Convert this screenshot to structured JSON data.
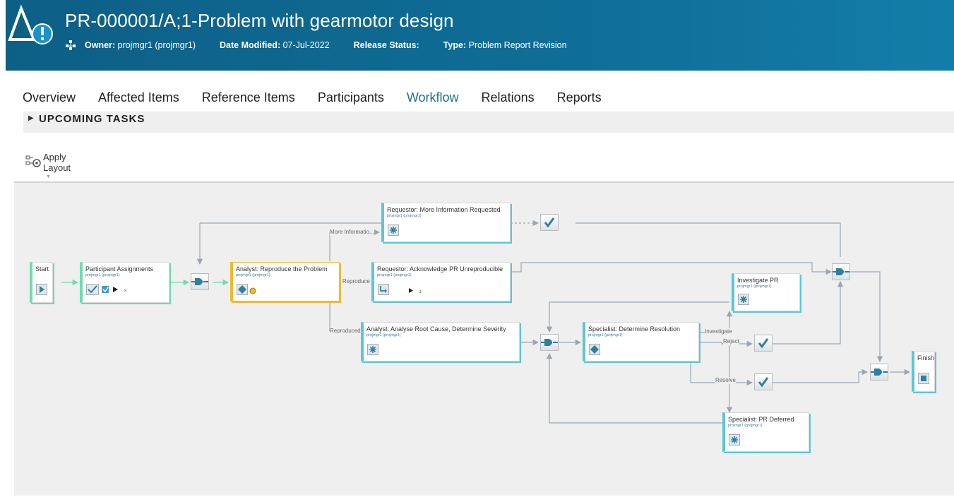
{
  "header": {
    "title": "PR-000001/A;1-Problem with gearmotor design",
    "owner_label": "Owner:",
    "owner_value": "projmgr1 (projmgr1)",
    "date_label": "Date Modified:",
    "date_value": "07-Jul-2022",
    "release_label": "Release Status:",
    "type_label": "Type:",
    "type_value": "Problem Report Revision",
    "header_color": "#0f6e97"
  },
  "tabs": [
    {
      "label": "Overview"
    },
    {
      "label": "Affected Items"
    },
    {
      "label": "Reference Items"
    },
    {
      "label": "Participants"
    },
    {
      "label": "Workflow",
      "active": true
    },
    {
      "label": "Relations"
    },
    {
      "label": "Reports"
    }
  ],
  "upcoming": {
    "label": "UPCOMING TASKS"
  },
  "toolbar": {
    "apply_layout_label": "Apply Layout"
  },
  "workflow": {
    "nodes": {
      "start": {
        "title": "Start"
      },
      "participant": {
        "title": "Participant Assignments",
        "owner": "projmgr1 (projmgr1)",
        "count": "s"
      },
      "reproduce": {
        "title": "Analyst: Reproduce the Problem",
        "owner": "projmgr1 (projmgr1)"
      },
      "more_info": {
        "title": "Requestor: More Information Requested",
        "owner": "projmgr1 (projmgr1)"
      },
      "acknowledge": {
        "title": "Requestor: Acknowledge PR Unreproducible",
        "owner": "projmgr1 (projmgr1)",
        "count": "z"
      },
      "analyse": {
        "title": "Analyst: Analyse Root Cause, Determine Severity",
        "owner": "projmgr1 (projmgr1)"
      },
      "determine": {
        "title": "Specialist: Determine Resolution",
        "owner": "projmgr1 (projmgr1)"
      },
      "investigate": {
        "title": "Investigate PR",
        "owner": "projmgr1 (projmgr1)"
      },
      "deferred": {
        "title": "Specialist: PR Deferred",
        "owner": "projmgr1 (projmgr1)"
      },
      "finish": {
        "title": "Finish"
      }
    },
    "edge_labels": {
      "more_info": "More Informatio...",
      "not_repro": "Cannot Reproduce",
      "reproduced": "Reproduced",
      "investigate": "Investigate",
      "reject": "Reject",
      "resolve": "Resolve"
    },
    "accent_colors": {
      "task": "#5bc6d6",
      "start": "#6fdcae",
      "active": "#f3b82e"
    }
  }
}
